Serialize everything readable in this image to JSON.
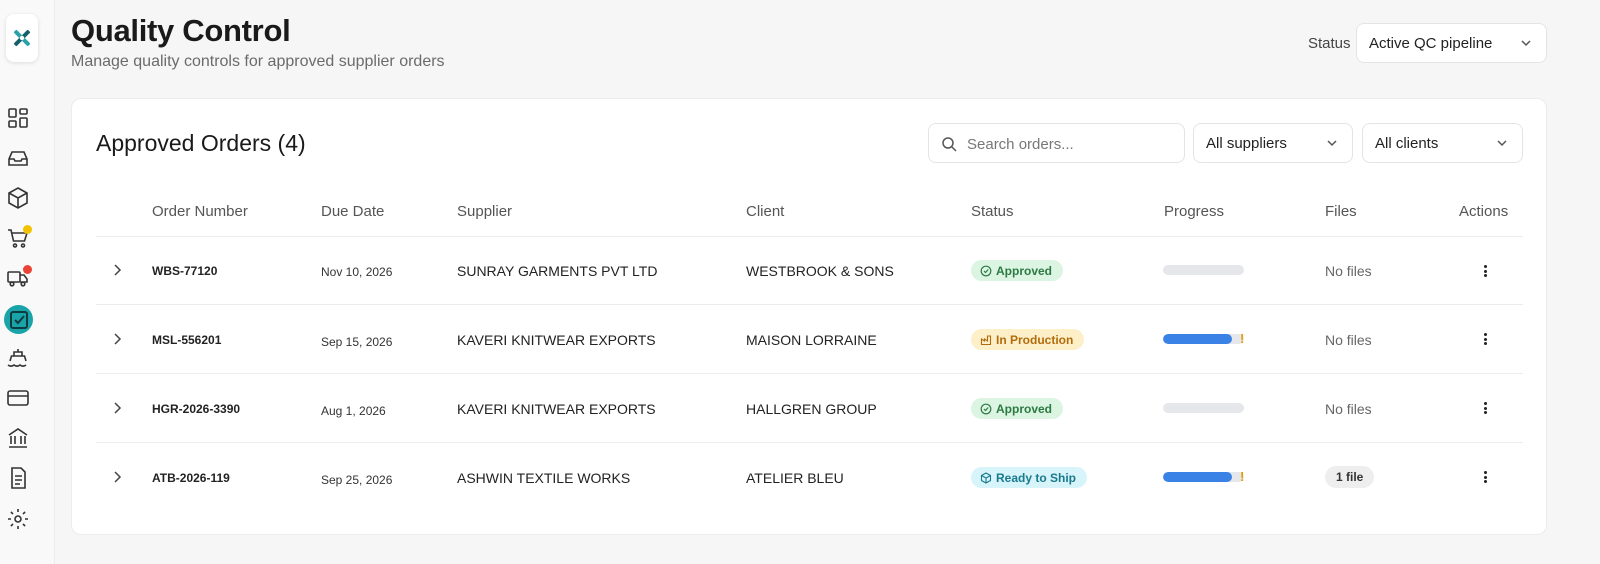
{
  "header": {
    "title": "Quality Control",
    "subtitle": "Manage quality controls for approved supplier orders",
    "status_label": "Status",
    "status_value": "Active QC pipeline"
  },
  "sidebar": {
    "icons": [
      "dashboard-icon",
      "inbox-icon",
      "package-icon",
      "cart-icon",
      "truck-icon",
      "checklist-icon",
      "ship-icon",
      "credit-card-icon",
      "bank-icon",
      "document-icon",
      "gear-icon"
    ],
    "active": "checklist-icon",
    "accent": "#1aa3a8"
  },
  "card": {
    "title": "Approved Orders (4)",
    "search_placeholder": "Search orders...",
    "supplier_filter": "All suppliers",
    "client_filter": "All clients"
  },
  "table": {
    "columns": {
      "order_number": "Order Number",
      "due_date": "Due Date",
      "supplier": "Supplier",
      "client": "Client",
      "status": "Status",
      "progress": "Progress",
      "files": "Files",
      "actions": "Actions"
    },
    "rows": [
      {
        "order_number": "WBS-77120",
        "due_date": "Nov 10, 2026",
        "supplier": "SUNRAY GARMENTS PVT LTD",
        "client": "WESTBROOK & SONS",
        "status": "Approved",
        "progress": 0,
        "warning": "",
        "files": "No files"
      },
      {
        "order_number": "MSL-556201",
        "due_date": "Sep 15, 2026",
        "supplier": "KAVERI KNITWEAR EXPORTS",
        "client": "MAISON LORRAINE",
        "status": "In Production",
        "progress": 0.85,
        "warning": "!",
        "files": "No files"
      },
      {
        "order_number": "HGR-2026-3390",
        "due_date": "Aug 1, 2026",
        "supplier": "KAVERI KNITWEAR EXPORTS",
        "client": "HALLGREN GROUP",
        "status": "Approved",
        "progress": 0,
        "warning": "",
        "files": "No files"
      },
      {
        "order_number": "ATB-2026-119",
        "due_date": "Sep 25, 2026",
        "supplier": "ASHWIN TEXTILE WORKS",
        "client": "ATELIER BLEU",
        "status": "Ready to Ship",
        "progress": 0.85,
        "warning": "!",
        "files": "1 file"
      }
    ]
  },
  "colors": {
    "approved_bg": "#dcf4e2",
    "production_bg": "#fdefc8",
    "ship_bg": "#d6f4fa",
    "progress_fill": "#3b82e6"
  }
}
